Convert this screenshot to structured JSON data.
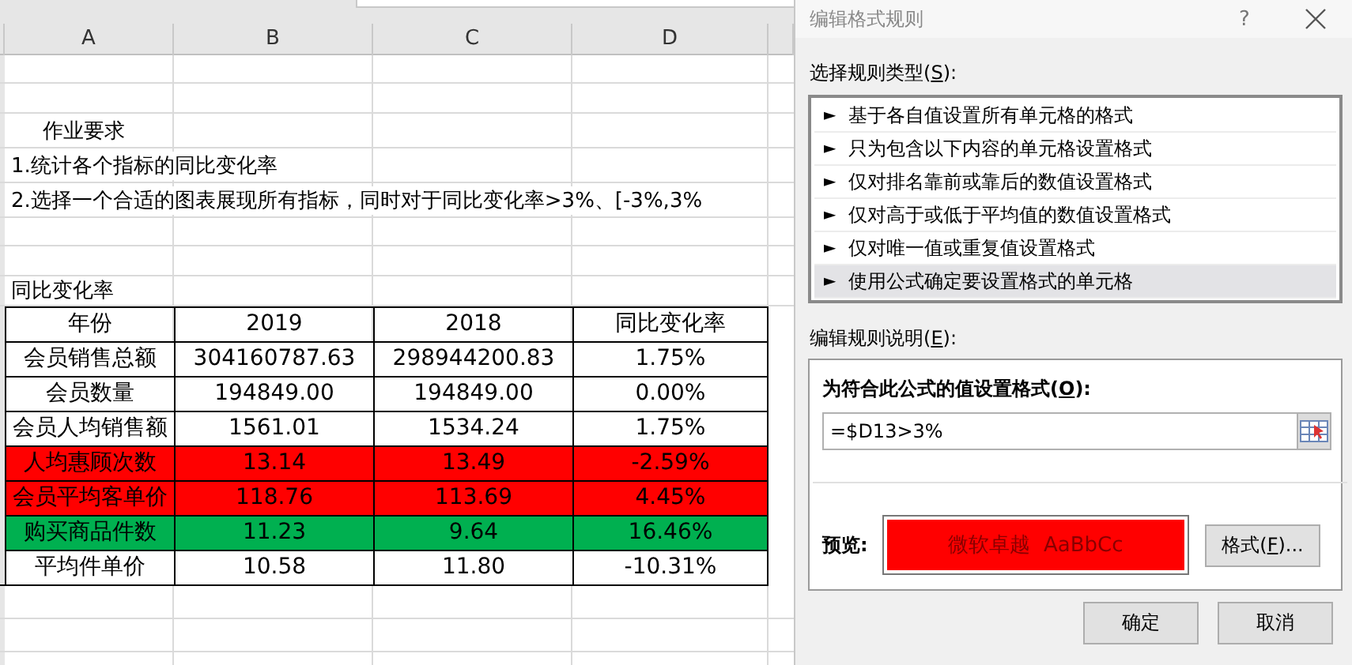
{
  "sheet": {
    "columns": [
      "A",
      "B",
      "C",
      "D"
    ],
    "notes": [
      {
        "kind": "title",
        "text": "作业要求"
      },
      {
        "kind": "line",
        "text": "1.统计各个指标的同比变化率"
      },
      {
        "kind": "line",
        "text": "2.选择一个合适的图表展现所有指标，同时对于同比变化率>3%、[-3%,3%"
      }
    ],
    "caption": "同比变化率",
    "table": {
      "columns": [
        "年份",
        "2019",
        "2018",
        "同比变化率"
      ],
      "rows": [
        {
          "color": "#ffffff",
          "cells": [
            "会员销售总额",
            "304160787.63",
            "298944200.83",
            "1.75%"
          ]
        },
        {
          "color": "#ffffff",
          "cells": [
            "会员数量",
            "194849.00",
            "194849.00",
            "0.00%"
          ]
        },
        {
          "color": "#ffffff",
          "cells": [
            "会员人均销售额",
            "1561.01",
            "1534.24",
            "1.75%"
          ]
        },
        {
          "color": "#ff0000",
          "cells": [
            "人均惠顾次数",
            "13.14",
            "13.49",
            "-2.59%"
          ]
        },
        {
          "color": "#ff0000",
          "cells": [
            "会员平均客单价",
            "118.76",
            "113.69",
            "4.45%"
          ]
        },
        {
          "color": "#00b050",
          "cells": [
            "购买商品件数",
            "11.23",
            "9.64",
            "16.46%"
          ]
        },
        {
          "color": "#ffffff",
          "cells": [
            "平均件单价",
            "10.58",
            "11.80",
            "-10.31%"
          ]
        }
      ]
    }
  },
  "dialog": {
    "title": "编辑格式规则",
    "help": "?",
    "rule_type_label": {
      "before": "选择规则类型(",
      "key": "S",
      "after": "):"
    },
    "rule_types": [
      {
        "marker": "►",
        "label": "基于各自值设置所有单元格的格式",
        "selected": false
      },
      {
        "marker": "►",
        "label": "只为包含以下内容的单元格设置格式",
        "selected": false
      },
      {
        "marker": "►",
        "label": "仅对排名靠前或靠后的数值设置格式",
        "selected": false
      },
      {
        "marker": "►",
        "label": "仅对高于或低于平均值的数值设置格式",
        "selected": false
      },
      {
        "marker": "►",
        "label": "仅对唯一值或重复值设置格式",
        "selected": false
      },
      {
        "marker": "►",
        "label": "使用公式确定要设置格式的单元格",
        "selected": true
      }
    ],
    "description_label": {
      "before": "编辑规则说明(",
      "key": "E",
      "after": "):"
    },
    "formula_label": {
      "before": "为符合此公式的值设置格式(",
      "key": "O",
      "after": "):"
    },
    "formula": "=$D13>3%",
    "preview_label": "预览:",
    "preview": {
      "text": "微软卓越  AaBbCc",
      "color": "#ff0000"
    },
    "format_button": {
      "before": "格式(",
      "key": "F",
      "after": ")..."
    },
    "buttons": [
      "确定",
      "取消"
    ]
  }
}
